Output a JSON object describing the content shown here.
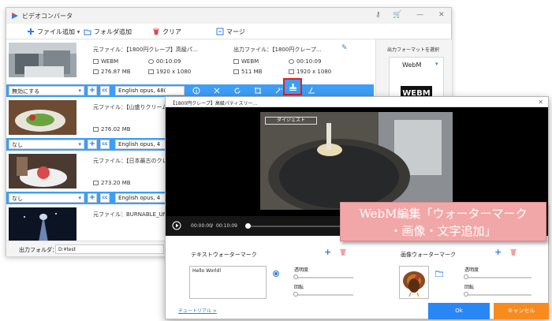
{
  "app": {
    "title": "ビデオコンバータ",
    "controls": {
      "key": "⚷",
      "cart": "🛒",
      "minimize": "—",
      "close": "✕"
    }
  },
  "toolbar": {
    "add_file": "ファイル追加",
    "add_folder": "フォルダ追加",
    "clear": "クリア",
    "merge": "マージ"
  },
  "files": [
    {
      "source": "元ファイル：【1800円クレープ】高級パ...",
      "format": "WEBM",
      "duration": "00:10:09",
      "size": "276.87 MB",
      "resolution": "1920 x 1080",
      "output": "出力ファイル：【1800円クレープ...",
      "out_format": "WEBM",
      "out_duration": "00:10:09",
      "out_size": "511 MB",
      "out_resolution": "1920 x 1080"
    },
    {
      "source": "元ファイル：【山盛りクリーム",
      "size": "276.02 MB"
    },
    {
      "source": "元ファイル：【日本最古のクレ",
      "size": "273.20 MB"
    },
    {
      "source": "元ファイル：BURNABLE_UNBURN"
    }
  ],
  "rows": [
    {
      "subtitle": "無効にする",
      "audio": "English opus, 48("
    },
    {
      "subtitle": "なし",
      "audio": "English opus, 4"
    },
    {
      "subtitle": "なし",
      "audio": "English opus, 4"
    },
    {
      "subtitle": "なし",
      "audio": "English opus, 4"
    }
  ],
  "right_panel": {
    "title": "出力フォーマットを選択",
    "format": "WebM",
    "badge": "WEBM"
  },
  "bottom": {
    "label": "出力フォルダ：",
    "path": "D:¥test"
  },
  "dialog": {
    "title": "【1800円クレープ】高級パティスリー...",
    "video_caption": "ダイジェスト",
    "time_current": "00:00:00",
    "time_total": "00:10:09",
    "progress": 0.0,
    "text_panel": {
      "title": "テキストウォーターマーク",
      "text": "Hello World!",
      "opacity": "透明度",
      "rotation": "回転"
    },
    "image_panel": {
      "title": "画像ウォーターマーク",
      "opacity": "透明度",
      "rotation": "回転"
    },
    "tutorial": "チュートリアル >",
    "ok": "Ok",
    "cancel": "キャンセル"
  },
  "annotation": {
    "line1": "WebM編集「ウォーターマーク",
    "line2": "・画像・文字追加」"
  },
  "colors": {
    "accent": "#3d9ef6",
    "annotation_bg": "#f1a7a7",
    "ok": "#2b86f5",
    "cancel": "#f78b1e"
  }
}
